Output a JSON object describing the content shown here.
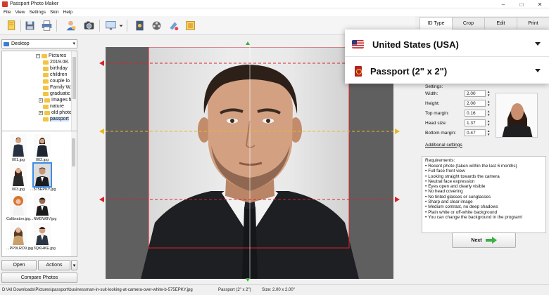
{
  "window": {
    "title": "Passport Photo Maker",
    "controls": [
      "–",
      "□",
      "✕"
    ]
  },
  "menu": [
    "File",
    "View",
    "Settings",
    "Skin",
    "Help"
  ],
  "toolbar": {
    "icons": [
      "open-project-icon",
      "save-icon",
      "print-icon",
      "user-photo-icon",
      "camera-icon",
      "monitor-icon",
      "photo-tools-icon",
      "film-icon",
      "paint-icon",
      "layout-icon"
    ]
  },
  "left_panel": {
    "folder": "Desktop",
    "tree": [
      {
        "label": "Pictures",
        "level": 0,
        "expanded": true
      },
      {
        "label": "2019.08.",
        "level": 1
      },
      {
        "label": "birthday",
        "level": 1
      },
      {
        "label": "children",
        "level": 1
      },
      {
        "label": "couple lo",
        "level": 1
      },
      {
        "label": "Family W.",
        "level": 1
      },
      {
        "label": "graduatic",
        "level": 1
      },
      {
        "label": "Images fr",
        "level": 1
      },
      {
        "label": "nature",
        "level": 1
      },
      {
        "label": "old photo",
        "level": 1
      },
      {
        "label": "passport",
        "level": 1,
        "selected": true
      }
    ],
    "thumbnails": [
      {
        "label": "001.jpg"
      },
      {
        "label": "002.jpg"
      },
      {
        "label": "003.jpg"
      },
      {
        "label": "...575EPKY.jpg",
        "selected": true
      },
      {
        "label": "Calibraton.jpg"
      },
      {
        "label": "...NMDW8V.jpg"
      },
      {
        "label": "...PP9LRD9.jpg"
      },
      {
        "label": "...3QKHKE.jpg"
      }
    ],
    "open_label": "Open",
    "actions_label": "Actions",
    "compare_label": "Compare Photos"
  },
  "right_panel": {
    "tabs": [
      "ID Type",
      "Crop",
      "Edit",
      "Print"
    ],
    "active_tab": "ID Type",
    "country": "United States (USA)",
    "document": "Passport (2\" x 2\")",
    "settings_label": "Settings:",
    "settings": [
      {
        "label": "Width:",
        "value": "2.00"
      },
      {
        "label": "Height:",
        "value": "2.00"
      },
      {
        "label": "Top margin:",
        "value": "0.16"
      },
      {
        "label": "Head size:",
        "value": "1.37"
      },
      {
        "label": "Bottom margin:",
        "value": "0.47"
      }
    ],
    "additional_settings": "Additional settings",
    "requirements_title": "Requirements:",
    "requirements": [
      "Recent photo (taken within the last 6 months)",
      "Full face front view",
      "Looking straight towards the camera",
      "Neutral face expression",
      "Eyes open and clearly visible",
      "No head covering",
      "No tinted glasses or sunglasses",
      "Sharp and clear image",
      "Medium contrast, no deep shadows",
      "Plain white or off-white background",
      "You can change the background in the program!"
    ],
    "next_label": "Next"
  },
  "status": {
    "path": "D:\\All Downloads\\Pictures\\passport\\businessman-in-suit-looking-at-camera-over-white-b-575EPKY.jpg",
    "format": "Passport (2\" x 2\")",
    "size": "Size: 2.00 x 2.00\""
  },
  "colors": {
    "guide_red": "#d9232a",
    "guide_yellow": "#e8b821",
    "guide_green": "#3cae3c",
    "selection_blue": "#3a8ee6",
    "next_arrow": "#3cb043"
  }
}
